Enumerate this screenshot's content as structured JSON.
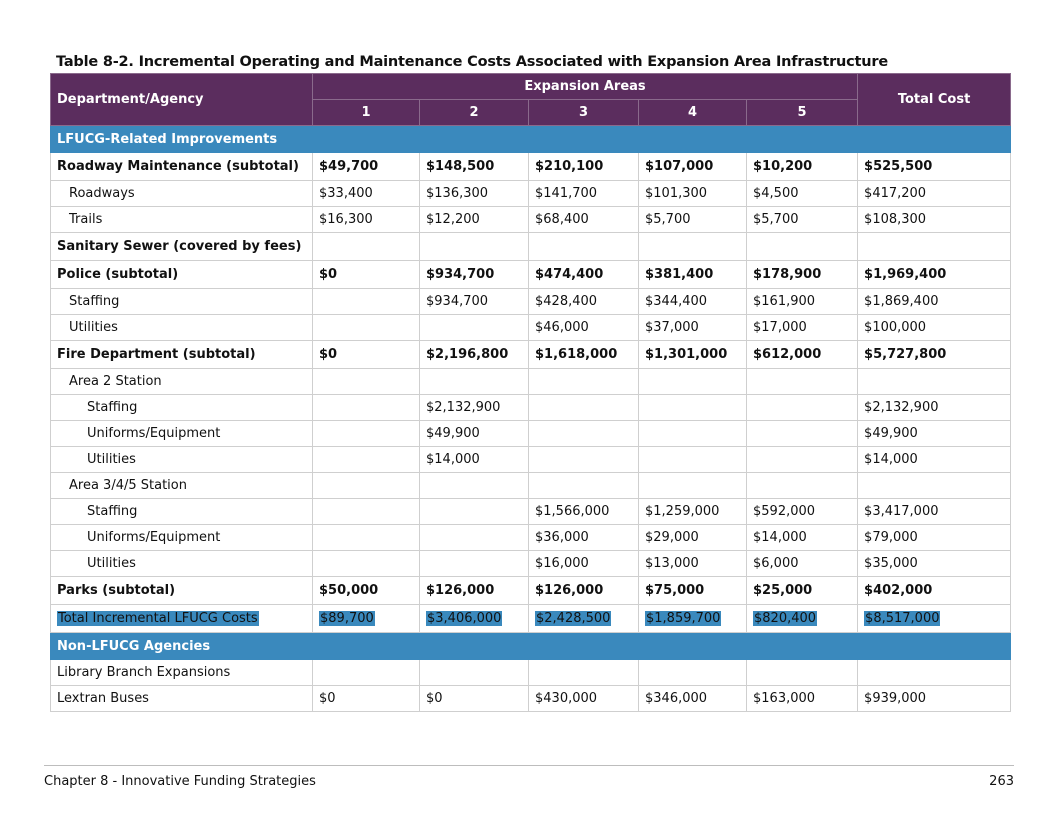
{
  "caption": "Table 8-2. Incremental Operating and Maintenance Costs Associated with Expansion Area Infrastructure",
  "header": {
    "dept": "Department/Agency",
    "group": "Expansion Areas",
    "areas": [
      "1",
      "2",
      "3",
      "4",
      "5"
    ],
    "total": "Total Cost"
  },
  "rows": [
    {
      "type": "section",
      "label": "LFUCG-Related Improvements"
    },
    {
      "type": "bold",
      "label": "Roadway Maintenance (subtotal)",
      "values": [
        "$49,700",
        "$148,500",
        "$210,100",
        "$107,000",
        "$10,200",
        "$525,500"
      ]
    },
    {
      "type": "ind1",
      "label": "Roadways",
      "values": [
        "$33,400",
        "$136,300",
        "$141,700",
        "$101,300",
        "$4,500",
        "$417,200"
      ]
    },
    {
      "type": "ind1",
      "label": "Trails",
      "values": [
        "$16,300",
        "$12,200",
        "$68,400",
        "$5,700",
        "$5,700",
        "$108,300"
      ]
    },
    {
      "type": "bold",
      "label": "Sanitary Sewer (covered by fees)",
      "values": [
        "",
        "",
        "",
        "",
        "",
        ""
      ]
    },
    {
      "type": "bold",
      "label": "Police (subtotal)",
      "values": [
        "$0",
        "$934,700",
        "$474,400",
        "$381,400",
        "$178,900",
        "$1,969,400"
      ]
    },
    {
      "type": "ind1",
      "label": "Staffing",
      "values": [
        "",
        "$934,700",
        "$428,400",
        "$344,400",
        "$161,900",
        "$1,869,400"
      ]
    },
    {
      "type": "ind1",
      "label": "Utilities",
      "values": [
        "",
        "",
        "$46,000",
        "$37,000",
        "$17,000",
        "$100,000"
      ]
    },
    {
      "type": "bold",
      "label": "Fire Department (subtotal)",
      "values": [
        "$0",
        "$2,196,800",
        "$1,618,000",
        "$1,301,000",
        "$612,000",
        "$5,727,800"
      ]
    },
    {
      "type": "ind1",
      "label": "Area 2 Station",
      "values": [
        "",
        "",
        "",
        "",
        "",
        ""
      ]
    },
    {
      "type": "ind2",
      "label": "Staffing",
      "values": [
        "",
        "$2,132,900",
        "",
        "",
        "",
        "$2,132,900"
      ]
    },
    {
      "type": "ind2",
      "label": "Uniforms/Equipment",
      "values": [
        "",
        "$49,900",
        "",
        "",
        "",
        "$49,900"
      ]
    },
    {
      "type": "ind2",
      "label": "Utilities",
      "values": [
        "",
        "$14,000",
        "",
        "",
        "",
        "$14,000"
      ]
    },
    {
      "type": "ind1",
      "label": "Area 3/4/5 Station",
      "values": [
        "",
        "",
        "",
        "",
        "",
        ""
      ]
    },
    {
      "type": "ind2",
      "label": "Staffing",
      "values": [
        "",
        "",
        "$1,566,000",
        "$1,259,000",
        "$592,000",
        "$3,417,000"
      ]
    },
    {
      "type": "ind2",
      "label": "Uniforms/Equipment",
      "values": [
        "",
        "",
        "$36,000",
        "$29,000",
        "$14,000",
        "$79,000"
      ]
    },
    {
      "type": "ind2",
      "label": "Utilities",
      "values": [
        "",
        "",
        "$16,000",
        "$13,000",
        "$6,000",
        "$35,000"
      ]
    },
    {
      "type": "bold",
      "label": "Parks (subtotal)",
      "values": [
        "$50,000",
        "$126,000",
        "$126,000",
        "$75,000",
        "$25,000",
        "$402,000"
      ]
    },
    {
      "type": "total",
      "label": "Total Incremental LFUCG Costs",
      "values": [
        "$89,700",
        "$3,406,000",
        "$2,428,500",
        "$1,859,700",
        "$820,400",
        "$8,517,000"
      ]
    },
    {
      "type": "section",
      "label": "Non-LFUCG Agencies"
    },
    {
      "type": "plain",
      "label": "Library Branch Expansions",
      "values": [
        "",
        "",
        "",
        "",
        "",
        ""
      ]
    },
    {
      "type": "plain",
      "label": "Lextran Buses",
      "values": [
        "$0",
        "$0",
        "$430,000",
        "$346,000",
        "$163,000",
        "$939,000"
      ]
    }
  ],
  "footer": {
    "chapter": "Chapter 8 - Innovative Funding Strategies",
    "page": "263"
  },
  "colors": {
    "header_purple": "#5b2d5e",
    "section_blue": "#3a89bd",
    "highlight_blue": "#3a89bd"
  }
}
